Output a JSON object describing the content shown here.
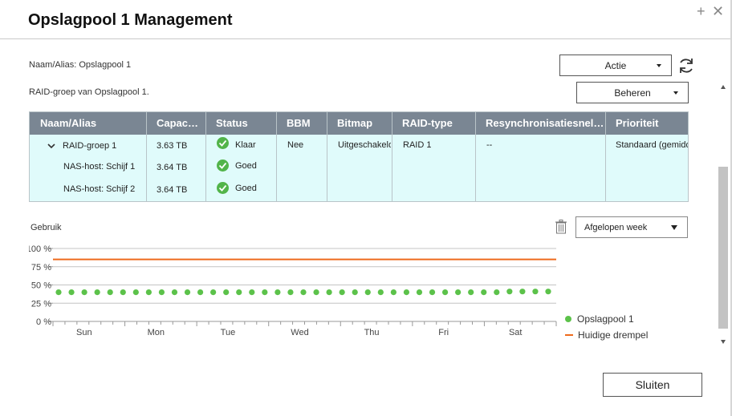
{
  "window": {
    "title": "Opslagpool 1 Management",
    "close_glyph": "✕",
    "plus_glyph": "+"
  },
  "info": {
    "alias_line": "Naam/Alias: Opslagpool 1",
    "raid_group_line": "RAID-groep van Opslagpool 1."
  },
  "actions": {
    "actie_label": "Actie",
    "beheren_label": "Beheren"
  },
  "table": {
    "columns": [
      "Naam/Alias",
      "Capac…",
      "Status",
      "BBM",
      "Bitmap",
      "RAID-type",
      "Resynchronisatiesnel…",
      "Prioriteit"
    ],
    "rows": [
      {
        "name": "RAID-groep 1",
        "capacity": "3.63 TB",
        "status": "Klaar",
        "bbm": "Nee",
        "bitmap": "Uitgeschakeld",
        "raid_type": "RAID 1",
        "resync": "--",
        "priority": "Standaard (gemiddeld)"
      },
      {
        "name": "NAS-host: Schijf 1",
        "capacity": "3.64 TB",
        "status": "Goed"
      },
      {
        "name": "NAS-host: Schijf 2",
        "capacity": "3.64 TB",
        "status": "Goed"
      }
    ]
  },
  "usage": {
    "label": "Gebruik",
    "period_selected": "Afgelopen week"
  },
  "chart_data": {
    "type": "line",
    "x_categories": [
      "Sun",
      "Mon",
      "Tue",
      "Wed",
      "Thu",
      "Fri",
      "Sat"
    ],
    "y_ticks": [
      "0 %",
      "25 %",
      "50 %",
      "75 %",
      "100 %"
    ],
    "ylim": [
      0,
      100
    ],
    "grid": true,
    "legend_position": "right",
    "series": [
      {
        "name": "Opslagpool 1",
        "color": "#5cc24a",
        "style": "points",
        "values": [
          40,
          40,
          40,
          40,
          40,
          40,
          40,
          40,
          40,
          40,
          40,
          40,
          40,
          40,
          40,
          40,
          40,
          40,
          40,
          40,
          40,
          40,
          40,
          40,
          40,
          40,
          40,
          40,
          40,
          40,
          40,
          40,
          40,
          40,
          40,
          41,
          41,
          41,
          41
        ]
      },
      {
        "name": "Huidige drempel",
        "color": "#ee6a1c",
        "style": "line",
        "values": [
          85,
          85
        ]
      }
    ]
  },
  "footer": {
    "close_label": "Sluiten"
  }
}
